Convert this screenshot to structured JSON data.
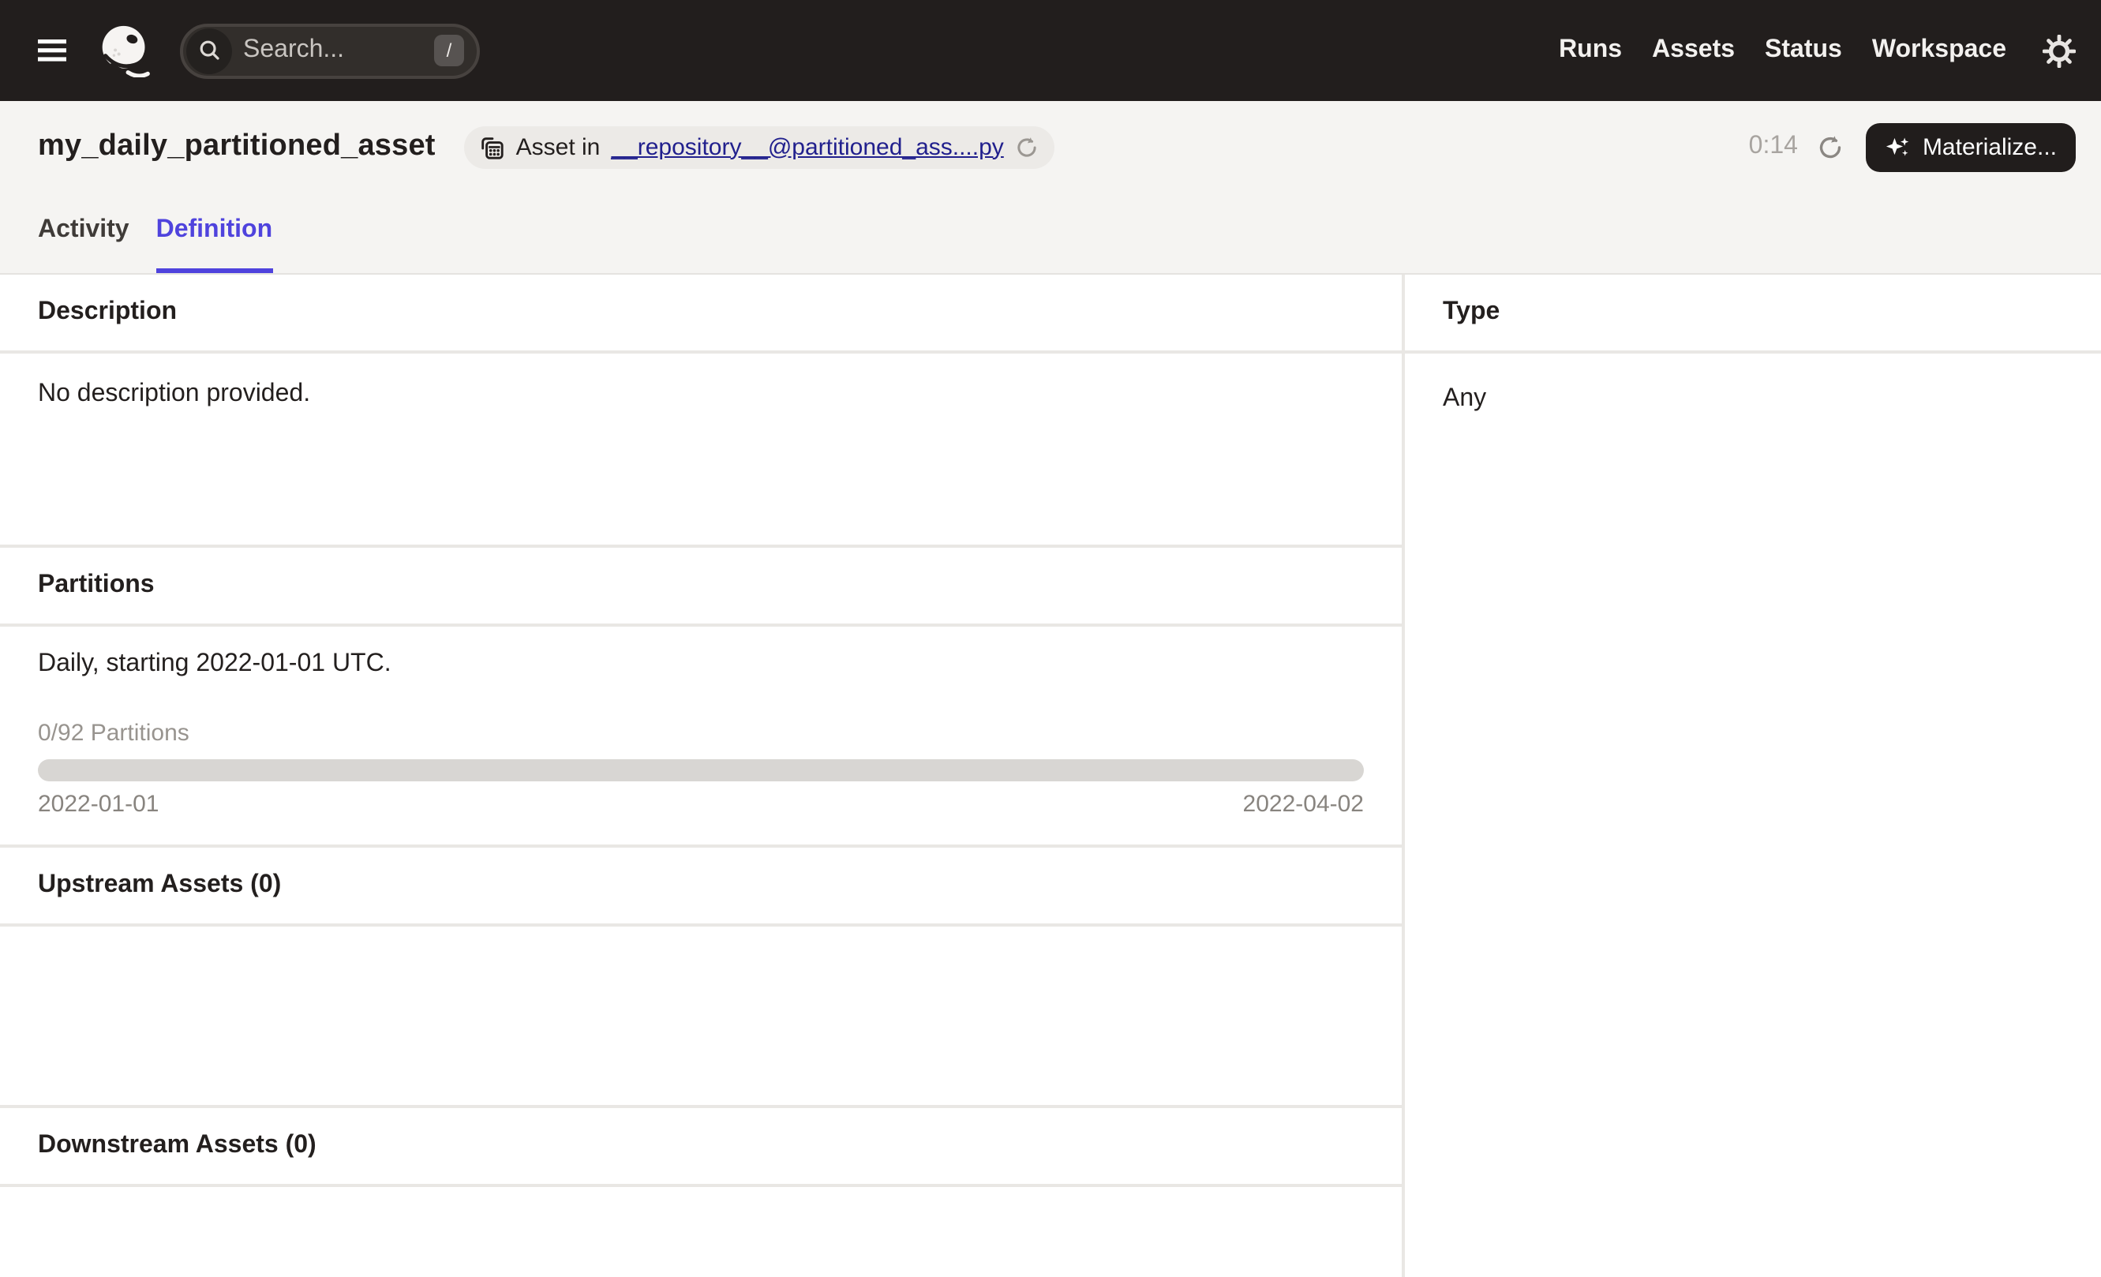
{
  "navbar": {
    "search": {
      "placeholder": "Search...",
      "shortcut": "/"
    },
    "links": [
      {
        "label": "Runs"
      },
      {
        "label": "Assets"
      },
      {
        "label": "Status"
      },
      {
        "label": "Workspace"
      }
    ]
  },
  "header": {
    "title": "my_daily_partitioned_asset",
    "badge": {
      "prefix": "Asset in",
      "link": "__repository__@partitioned_ass....py"
    },
    "timer": "0:14",
    "materialize_label": "Materialize..."
  },
  "tabs": [
    {
      "label": "Activity",
      "active": false
    },
    {
      "label": "Definition",
      "active": true
    }
  ],
  "sections": {
    "description": {
      "title": "Description",
      "body": "No description provided."
    },
    "partitions": {
      "title": "Partitions",
      "definition": "Daily, starting 2022-01-01 UTC.",
      "progress_label": "0/92 Partitions",
      "progress_fraction": 0,
      "range_start": "2022-01-01",
      "range_end": "2022-04-02"
    },
    "upstream": {
      "title": "Upstream Assets (0)"
    },
    "downstream": {
      "title": "Downstream Assets (0)"
    },
    "type": {
      "title": "Type",
      "value": "Any"
    }
  },
  "icons": {
    "menu": "hamburger",
    "logo": "dagster-octopus",
    "search": "magnifier",
    "settings": "gear",
    "asset_group": "grid-copy",
    "reload": "circular-arrow",
    "materialize": "sparkles"
  },
  "colors": {
    "navbar_bg": "#221E1D",
    "header_bg": "#F5F4F2",
    "accent": "#4F43DD",
    "link": "#21208D",
    "progress_track": "#D8D6D3",
    "divider": "#E9E7E4",
    "button_bg": "#211D1C"
  }
}
